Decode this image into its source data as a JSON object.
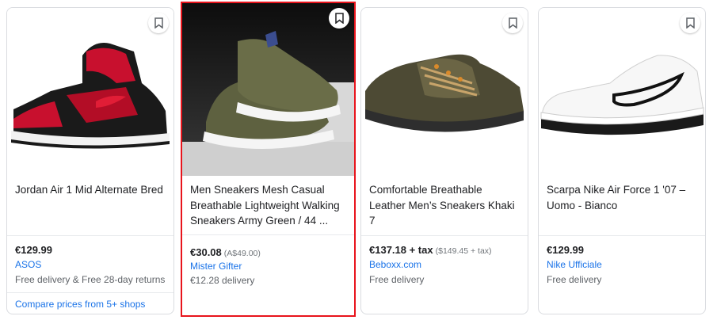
{
  "cards": [
    {
      "title": "Jordan Air 1 Mid Alternate Bred",
      "price": "€129.99",
      "original_price": "",
      "seller": "ASOS",
      "delivery": "Free delivery & Free 28-day returns",
      "compare": "Compare prices from 5+ shops"
    },
    {
      "title": "Men Sneakers Mesh Casual Breathable Lightweight Walking Sneakers Army Green / 44 ...",
      "price": "€30.08",
      "original_price": "(A$49.00)",
      "seller": "Mister Gifter",
      "delivery": "€12.28 delivery"
    },
    {
      "title": "Comfortable Breathable Leather Men’s Sneakers Khaki 7",
      "price": "€137.18 + tax",
      "original_price": "($149.45 + tax)",
      "seller": "Beboxx.com",
      "delivery": "Free delivery"
    },
    {
      "title": "Scarpa Nike Air Force 1 '07 – Uomo - Bianco",
      "price": "€129.99",
      "original_price": "",
      "seller": "Nike Ufficiale",
      "delivery": "Free delivery"
    }
  ],
  "icons": {
    "save": "bookmark-icon"
  },
  "colors": {
    "selected_border": "#e8141c",
    "link": "#1a73e8"
  }
}
